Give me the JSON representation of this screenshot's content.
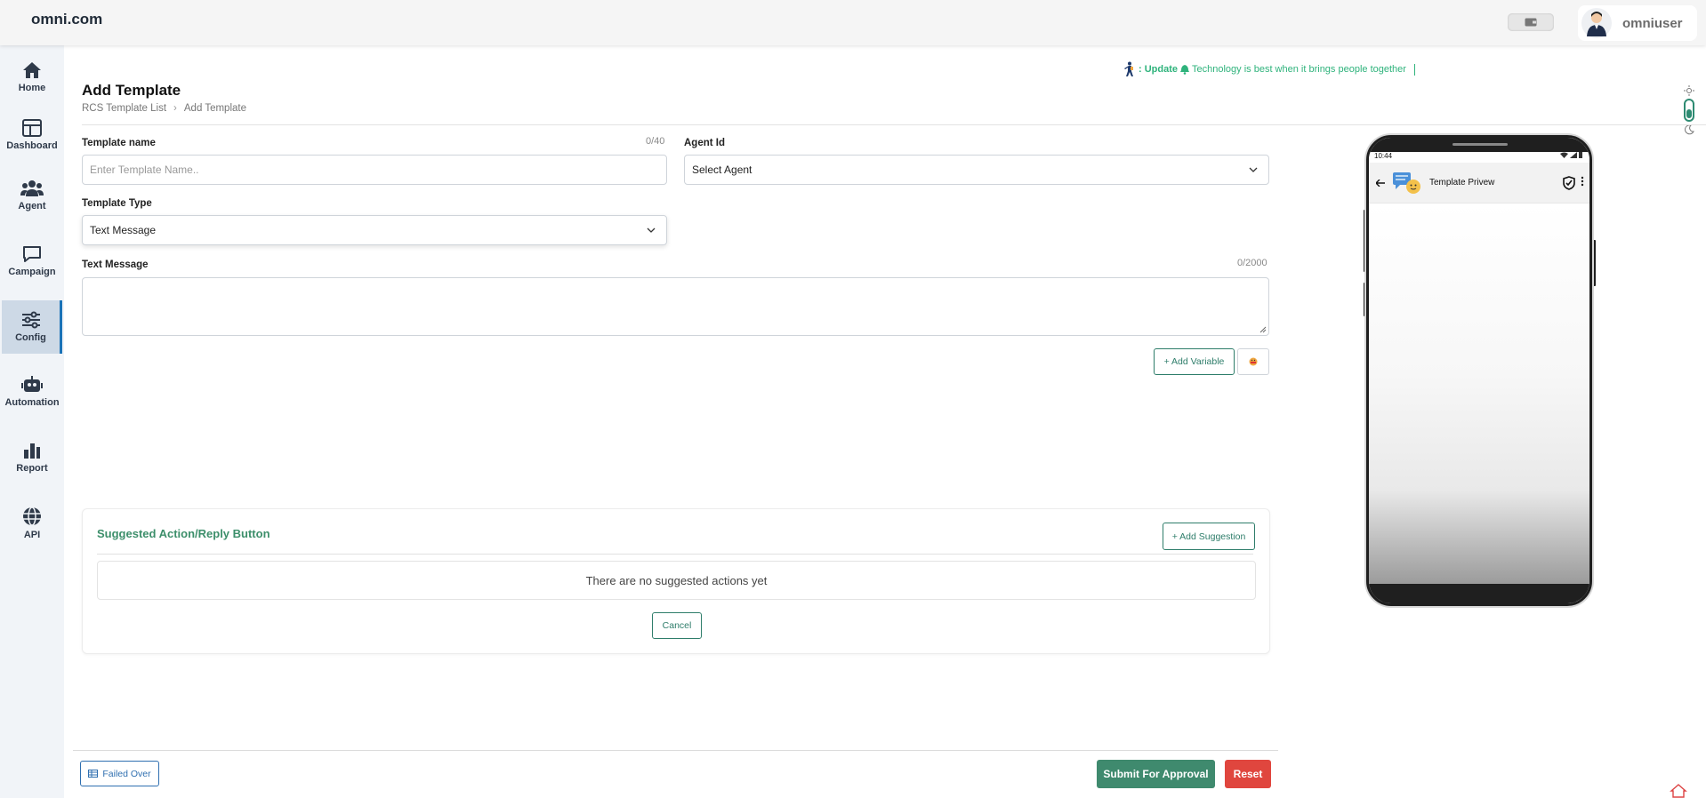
{
  "app": {
    "logo": "omni.com",
    "username": "omniuser"
  },
  "sidebar": {
    "items": [
      {
        "label": "Home",
        "icon": "home-icon"
      },
      {
        "label": "Dashboard",
        "icon": "dashboard-icon"
      },
      {
        "label": "Agent",
        "icon": "users-icon"
      },
      {
        "label": "Campaign",
        "icon": "chat-bubble-icon"
      },
      {
        "label": "Config",
        "icon": "sliders-icon",
        "active": true
      },
      {
        "label": "Automation",
        "icon": "robot-icon"
      },
      {
        "label": "Report",
        "icon": "bar-chart-icon"
      },
      {
        "label": "API",
        "icon": "globe-icon"
      }
    ]
  },
  "ticker": {
    "prefix": ": Update",
    "message": "Technology is best when it brings people together"
  },
  "page": {
    "title": "Add Template",
    "breadcrumb": [
      "RCS Template List",
      "Add Template"
    ]
  },
  "form": {
    "template_name": {
      "label": "Template name",
      "placeholder": "Enter Template Name..",
      "counter": "0/40"
    },
    "agent_id": {
      "label": "Agent Id",
      "value": "Select Agent"
    },
    "template_type": {
      "label": "Template Type",
      "value": "Text Message"
    },
    "text_message": {
      "label": "Text Message",
      "counter": "0/2000"
    },
    "add_variable": "+ Add Variable"
  },
  "suggestions": {
    "title": "Suggested Action/Reply Button",
    "add_button": "+ Add Suggestion",
    "empty_text": "There are no suggested actions yet",
    "cancel": "Cancel"
  },
  "footer": {
    "failed_over": "Failed Over",
    "submit": "Submit For Approval",
    "reset": "Reset"
  },
  "preview": {
    "time": "10:44",
    "title": "Template Privew"
  },
  "colors": {
    "primary_green": "#3f8a6e",
    "reset_red": "#e0463e",
    "link_blue": "#2f6fb0",
    "ticker_green": "#2fb37c",
    "sidebar_bg": "#f1f4f8"
  }
}
